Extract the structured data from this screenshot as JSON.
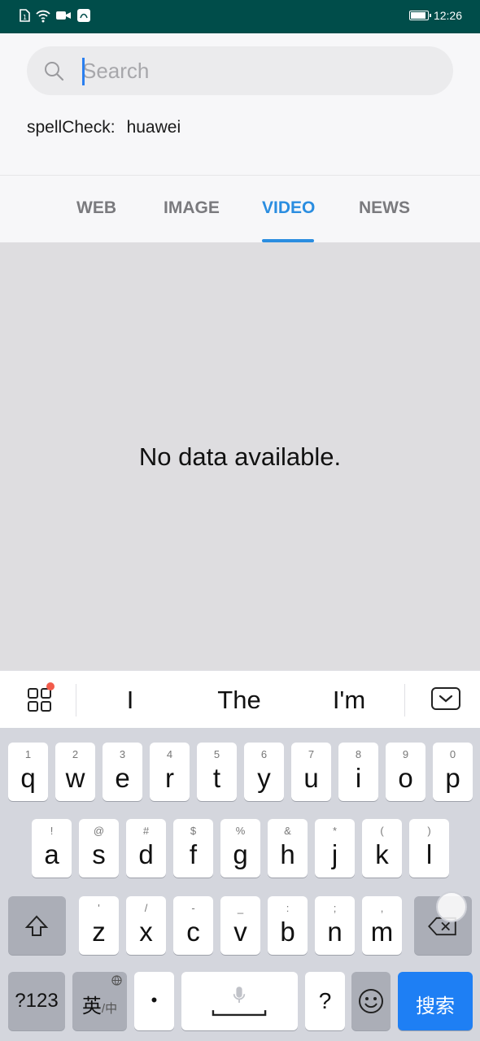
{
  "status_bar": {
    "time": "12:26",
    "battery_level": 0.95,
    "icons": [
      "sim-icon",
      "wifi-icon",
      "video-icon",
      "app-notification-icon"
    ]
  },
  "search": {
    "placeholder": "Search",
    "value": "",
    "spellcheck_label": "spellCheck:",
    "spellcheck_value": "huawei"
  },
  "tabs": [
    {
      "label": "WEB",
      "active": false
    },
    {
      "label": "IMAGE",
      "active": false
    },
    {
      "label": "VIDEO",
      "active": true
    },
    {
      "label": "NEWS",
      "active": false
    }
  ],
  "content": {
    "empty_message": "No data available."
  },
  "keyboard": {
    "suggestions": [
      "I",
      "The",
      "I'm"
    ],
    "row1": [
      {
        "hint": "1",
        "key": "q"
      },
      {
        "hint": "2",
        "key": "w"
      },
      {
        "hint": "3",
        "key": "e"
      },
      {
        "hint": "4",
        "key": "r"
      },
      {
        "hint": "5",
        "key": "t"
      },
      {
        "hint": "6",
        "key": "y"
      },
      {
        "hint": "7",
        "key": "u"
      },
      {
        "hint": "8",
        "key": "i"
      },
      {
        "hint": "9",
        "key": "o"
      },
      {
        "hint": "0",
        "key": "p"
      }
    ],
    "row2": [
      {
        "hint": "!",
        "key": "a"
      },
      {
        "hint": "@",
        "key": "s"
      },
      {
        "hint": "#",
        "key": "d"
      },
      {
        "hint": "$",
        "key": "f"
      },
      {
        "hint": "%",
        "key": "g"
      },
      {
        "hint": "&",
        "key": "h"
      },
      {
        "hint": "*",
        "key": "j"
      },
      {
        "hint": "(",
        "key": "k"
      },
      {
        "hint": ")",
        "key": "l"
      }
    ],
    "row3": [
      {
        "hint": "'",
        "key": "z"
      },
      {
        "hint": "/",
        "key": "x"
      },
      {
        "hint": "-",
        "key": "c"
      },
      {
        "hint": "_",
        "key": "v"
      },
      {
        "hint": ":",
        "key": "b"
      },
      {
        "hint": ";",
        "key": "n"
      },
      {
        "hint": ",",
        "key": "m"
      }
    ],
    "symbols_key": "?123",
    "lang_key_main": "英",
    "lang_key_sub": "/中",
    "dot_key": "•",
    "question_key": "?",
    "search_key": "搜索"
  }
}
